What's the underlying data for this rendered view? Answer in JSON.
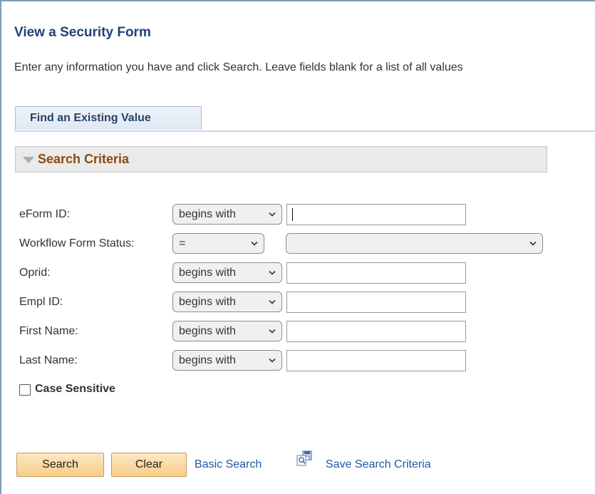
{
  "page": {
    "title": "View a Security Form",
    "instructions": "Enter any information you have and click Search. Leave fields blank for a list of all values"
  },
  "tab": {
    "label": "Find an Existing Value"
  },
  "section": {
    "title": "Search Criteria"
  },
  "fields": [
    {
      "label": "eForm ID:",
      "operator": "begins with",
      "value": ""
    },
    {
      "label": "Workflow Form Status:",
      "operator": "=",
      "value": ""
    },
    {
      "label": "Oprid:",
      "operator": "begins with",
      "value": ""
    },
    {
      "label": "Empl ID:",
      "operator": "begins with",
      "value": ""
    },
    {
      "label": "First Name:",
      "operator": "begins with",
      "value": ""
    },
    {
      "label": "Last Name:",
      "operator": "begins with",
      "value": ""
    }
  ],
  "case_sensitive": {
    "label": "Case Sensitive",
    "checked": false
  },
  "actions": {
    "search_label": "Search",
    "clear_label": "Clear",
    "basic_search_label": "Basic Search",
    "save_search_label": "Save Search Criteria",
    "save_icon": "save-search-icon"
  },
  "colors": {
    "title": "#23417a",
    "section_title": "#8d4a12",
    "link": "#2356a5",
    "button": "#f8ce88"
  }
}
